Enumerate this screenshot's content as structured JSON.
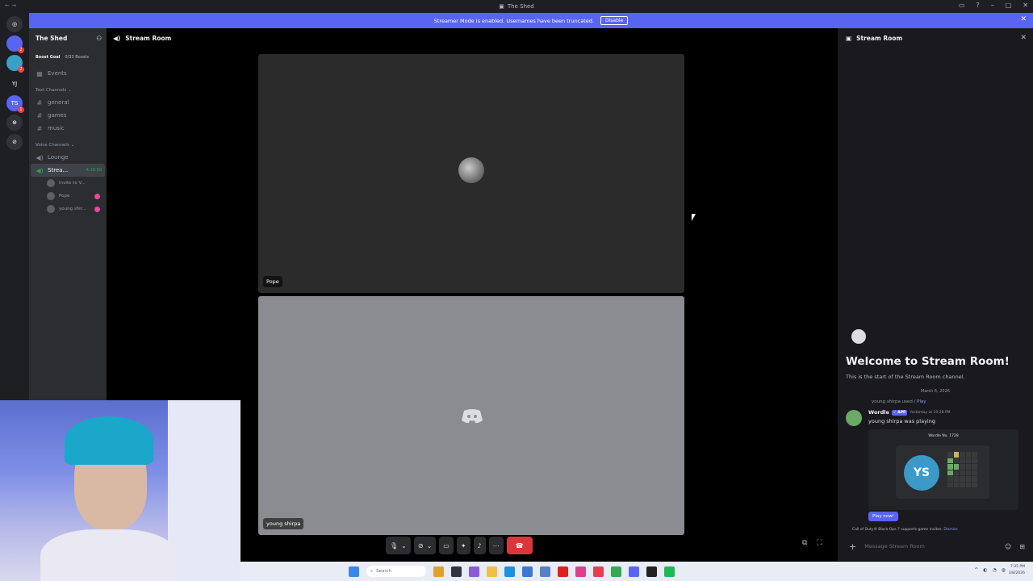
{
  "titlebar": {
    "title": "The Shed",
    "nav": "← →"
  },
  "banner": {
    "text": "Streamer Mode is enabled. Usernames have been truncated.",
    "disable_label": "Disable"
  },
  "servers": [
    {
      "label": "",
      "badge": ""
    },
    {
      "label": "",
      "badge": "2"
    },
    {
      "label": "",
      "badge": "2"
    },
    {
      "label": "YJ",
      "badge": ""
    },
    {
      "label": "TS",
      "badge": "1"
    },
    {
      "label": "",
      "badge": ""
    },
    {
      "label": "",
      "badge": ""
    }
  ],
  "guild": {
    "name": "The Shed",
    "boost_goal": "Boost Goal",
    "boost_count": "0/33 Boosts",
    "events": "Events",
    "text_category": "Text Channels",
    "text_channels": [
      "general",
      "games",
      "music"
    ],
    "voice_category": "Voice Channels",
    "voice_channels": [
      "Lounge",
      "Strea..."
    ],
    "voice_timer": "4:18:58",
    "invite": "Invite to V...",
    "members": [
      "Pope",
      "young shir..."
    ]
  },
  "voice": {
    "title": "Stream Room",
    "tiles": [
      "Pope",
      "young shirpa"
    ]
  },
  "panel": {
    "title": "Stream Room",
    "welcome": "Welcome to Stream Room!",
    "start": "This is the start of the Stream Room channel.",
    "date": "March 6, 2026",
    "used_by": "young shirpa used",
    "used_cmd": "/ Play",
    "app_name": "Wordle",
    "app_badge": "✓ APP",
    "timestamp": "Yesterday at 10:28 PM",
    "playing": "young shirpa was playing",
    "wordle_no": "Wordle No. 1728",
    "initials": "YS",
    "play_now": "Play now!",
    "cod_text": "Call of Duty® Black Ops 7 supports game invites.",
    "dismiss": "Dismiss",
    "input_placeholder": "Message Stream Room"
  },
  "taskbar": {
    "search": "Search",
    "time": "7:35 PM",
    "date": "3/8/2026"
  },
  "colors": {
    "blurple": "#5865f2",
    "hangup": "#da373c",
    "green": "#23a55a"
  }
}
